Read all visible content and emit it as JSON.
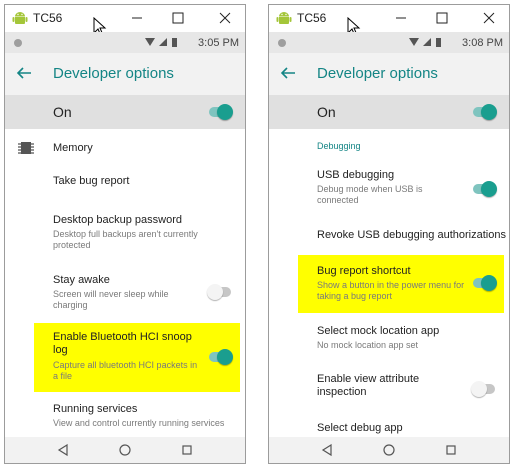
{
  "window_title": "TC56",
  "colors": {
    "accent": "#148585",
    "toggle_on": "#1a9e8f",
    "highlight": "#ffff00"
  },
  "left": {
    "status_time": "3:05 PM",
    "header_title": "Developer options",
    "master_label": "On",
    "items": [
      {
        "title": "Memory",
        "subtitle": ""
      },
      {
        "title": "Take bug report",
        "subtitle": ""
      },
      {
        "title": "Desktop backup password",
        "subtitle": "Desktop full backups aren't currently protected"
      },
      {
        "title": "Stay awake",
        "subtitle": "Screen will never sleep while charging"
      },
      {
        "title": "Enable Bluetooth HCI snoop log",
        "subtitle": "Capture all bluetooth HCI packets in a file"
      },
      {
        "title": "Running services",
        "subtitle": "View and control currently running services"
      }
    ]
  },
  "right": {
    "status_time": "3:08 PM",
    "header_title": "Developer options",
    "master_label": "On",
    "section_label": "Debugging",
    "items": [
      {
        "title": "USB debugging",
        "subtitle": "Debug mode when USB is connected"
      },
      {
        "title": "Revoke USB debugging authorizations",
        "subtitle": ""
      },
      {
        "title": "Bug report shortcut",
        "subtitle": "Show a button in the power menu for taking a bug report"
      },
      {
        "title": "Select mock location app",
        "subtitle": "No mock location app set"
      },
      {
        "title": "Enable view attribute inspection",
        "subtitle": ""
      },
      {
        "title": "Select debug app",
        "subtitle": ""
      }
    ]
  }
}
